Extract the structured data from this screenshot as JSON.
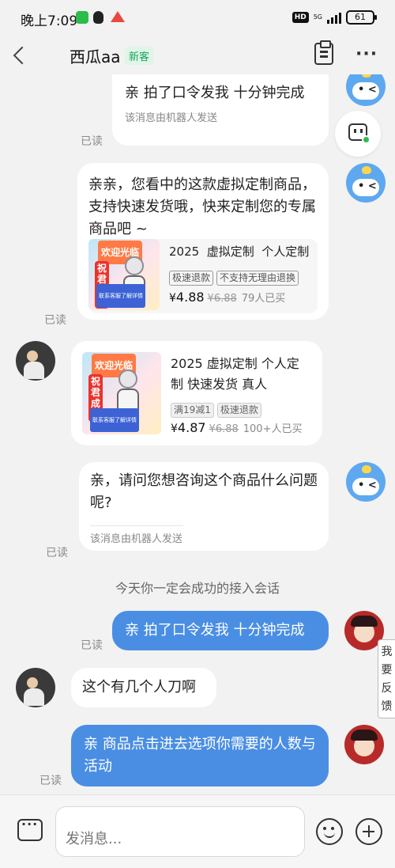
{
  "status_bar": {
    "time": "晚上7:09",
    "hd": "HD",
    "network": "5G",
    "battery": "61"
  },
  "header": {
    "contact_name": "西瓜aa",
    "contact_badge": "新客"
  },
  "messages": [
    {
      "from": "bot",
      "text": "亲 拍了口令发我 十分钟完成",
      "note": "该消息由机器人发送",
      "read": "已读"
    },
    {
      "from": "bot",
      "text": "亲亲，您看中的这款虚拟定制商品，支持快速发货哦，快来定制您的专属商品吧 ~",
      "read": "已读",
      "product": {
        "thumb_welcome": "欢迎光临",
        "thumb_wish": "祝君成功",
        "thumb_strip": "联系客服了解详情",
        "title": "2025  虚拟定制  个人定制",
        "tags": [
          "极速退款",
          "不支持无理由退换"
        ],
        "currency": "¥",
        "price": "4.88",
        "old_price": "¥6.88",
        "sold": "79人已买"
      }
    },
    {
      "from": "user",
      "product": {
        "thumb_welcome": "欢迎光临",
        "thumb_wish": "祝君成功",
        "thumb_strip": "联系客服了解详情",
        "title": "2025  虚拟定制 个人定制  快速发货 真人",
        "tags": [
          "满19减1",
          "极速退款"
        ],
        "currency": "¥",
        "price": "4.87",
        "old_price": "¥6.88",
        "sold": "100+人已买"
      }
    },
    {
      "from": "bot",
      "text": "亲，请问您想咨询这个商品什么问题呢?",
      "note": "该消息由机器人发送",
      "read": "已读"
    },
    {
      "from": "system",
      "text": "今天你一定会成功的接入会话"
    },
    {
      "from": "agent",
      "text": "亲 拍了口令发我 十分钟完成",
      "read": "已读"
    },
    {
      "from": "user",
      "text": "这个有几个人刀啊"
    },
    {
      "from": "agent",
      "text": "亲 商品点击进去选项你需要的人数与活动",
      "read": "已读"
    }
  ],
  "feedback": [
    "我",
    "要",
    "反",
    "馈"
  ],
  "input": {
    "placeholder": "发消息..."
  }
}
